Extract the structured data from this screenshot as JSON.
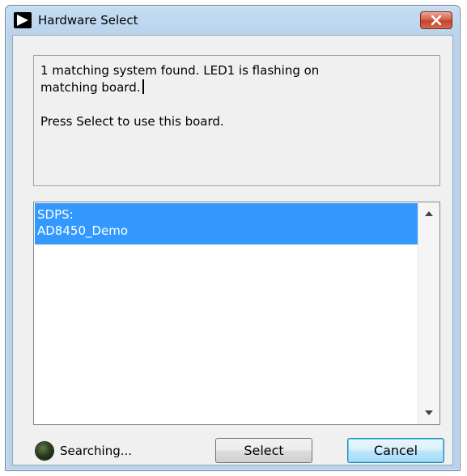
{
  "window": {
    "title": "Hardware Select"
  },
  "message": {
    "line1": "1 matching system found. LED1 is flashing on",
    "line2": "matching board.",
    "line3": "Press Select to use this board."
  },
  "device_list": {
    "items": [
      {
        "line1": "SDPS:",
        "line2": "AD8450_Demo",
        "selected": true
      }
    ]
  },
  "status": {
    "indicator_color": "#2a3f1f",
    "text": "Searching..."
  },
  "buttons": {
    "select_label": "Select",
    "cancel_label": "Cancel"
  },
  "colors": {
    "selection": "#3399ff",
    "close_button": "#c9482f"
  },
  "icons": {
    "app": "play-arrow-icon",
    "close": "close-icon",
    "scroll_up": "chevron-up-icon",
    "scroll_down": "chevron-down-icon"
  }
}
